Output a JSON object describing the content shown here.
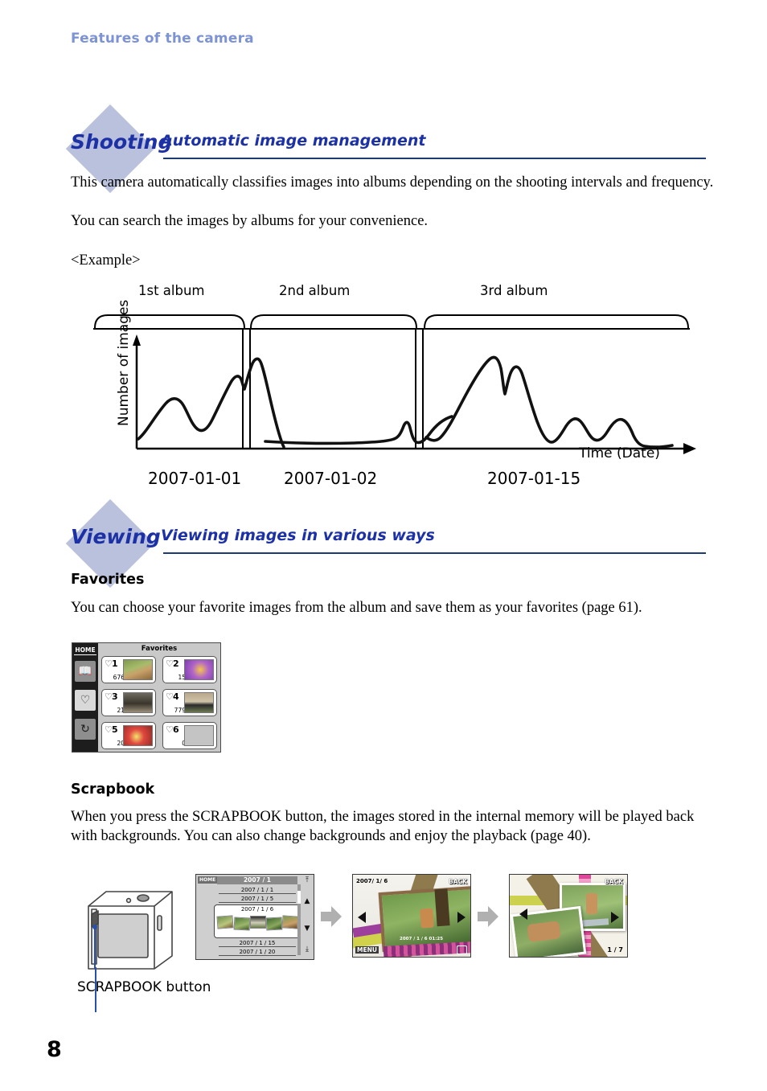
{
  "running_head": "Features of the camera",
  "page_number": "8",
  "sections": {
    "shooting": {
      "tag": "Shooting",
      "title": "Automatic image management",
      "paragraph1": "This camera automatically classifies images into albums depending on the shooting intervals and frequency.",
      "paragraph2": "You can search the images by albums for your convenience.",
      "example_label": "<Example>"
    },
    "viewing": {
      "tag": "Viewing",
      "title": "Viewing images in various ways",
      "favorites": {
        "heading": "Favorites",
        "body": "You can choose your favorite images from the album and save them as your favorites (page 61)."
      },
      "scrapbook": {
        "heading": "Scrapbook",
        "body": "When you press the SCRAPBOOK button, the images stored in the internal memory will be played back with backgrounds. You can also change backgrounds and enjoy the playback (page 40).",
        "caption": "SCRAPBOOK button"
      }
    }
  },
  "chart_data": {
    "type": "line",
    "title": "",
    "xlabel": "Time (Date)",
    "ylabel": "Number of images",
    "grid": false,
    "legend": "none",
    "album_labels": [
      "1st album",
      "2nd album",
      "3rd album"
    ],
    "date_labels": [
      "2007-01-01",
      "2007-01-02",
      "2007-01-15"
    ],
    "xlim": [
      0,
      100
    ],
    "ylim": [
      0,
      100
    ],
    "series": [
      {
        "name": "1st album",
        "x": [
          2,
          6,
          10,
          13,
          16,
          19,
          22,
          26,
          30,
          33,
          35,
          37,
          39,
          41,
          43,
          45
        ],
        "y": [
          18,
          30,
          42,
          46,
          40,
          28,
          24,
          34,
          50,
          62,
          72,
          68,
          60,
          78,
          88,
          10
        ]
      },
      {
        "name": "2nd album",
        "x": [
          48,
          55,
          62,
          68,
          74,
          78,
          80,
          82,
          85,
          88,
          92,
          96
        ],
        "y": [
          8,
          7,
          7,
          7,
          7,
          8,
          9,
          22,
          10,
          9,
          18,
          26
        ]
      },
      {
        "name": "3rd album",
        "x": [
          100,
          104,
          108,
          113,
          118,
          122,
          125,
          127,
          129,
          132,
          136,
          140,
          145,
          150,
          155,
          160,
          165,
          170,
          175,
          180,
          186,
          192,
          198
        ],
        "y": [
          14,
          10,
          22,
          42,
          62,
          78,
          86,
          88,
          52,
          70,
          76,
          60,
          40,
          20,
          14,
          30,
          32,
          20,
          18,
          32,
          34,
          8,
          6
        ]
      }
    ]
  },
  "favorites_screen": {
    "home_label": "HOME",
    "title": "Favorites",
    "side_icons": [
      "album-book-icon",
      "heart-icon",
      "rotate-icon"
    ],
    "selected_side_icon": "heart-icon",
    "cells": [
      {
        "index": "1",
        "count": "676",
        "thumb": "dog"
      },
      {
        "index": "2",
        "count": "15",
        "thumb": "flower"
      },
      {
        "index": "3",
        "count": "21",
        "thumb": "tree"
      },
      {
        "index": "4",
        "count": "779",
        "thumb": "cat"
      },
      {
        "index": "5",
        "count": "20",
        "thumb": "red-flower"
      },
      {
        "index": "6",
        "count": "0",
        "thumb": "empty"
      }
    ]
  },
  "scrapbook_screens": {
    "screen1": {
      "home_label": "HOME",
      "header": "2007 / 1",
      "rows": [
        "2007 / 1 / 1",
        "2007 / 1 / 5"
      ],
      "selected_row": "2007 / 1 / 6",
      "rows_after": [
        "2007 / 1 / 15",
        "2007 / 1 / 20"
      ],
      "nav_icons": [
        "jump-top-icon",
        "scroll-up-icon",
        "scroll-down-icon",
        "jump-bottom-icon"
      ]
    },
    "screen2": {
      "date": "2007/ 1/ 6",
      "back_label": "BACK",
      "menu_label": "MENU",
      "overlay_text": "2007 / 1 / 6 01:25",
      "left_arrow": "prev-arrow-icon",
      "right_arrow": "next-arrow-icon"
    },
    "screen3": {
      "back_label": "BACK",
      "counter": "1 / 7"
    }
  },
  "colors": {
    "running_head": "#7e93d4",
    "heading_blue": "#1d31a6",
    "rule_blue": "#1d3a72",
    "diamond": "#b9c1dc",
    "arrow_gray": "#b0b0b0"
  }
}
